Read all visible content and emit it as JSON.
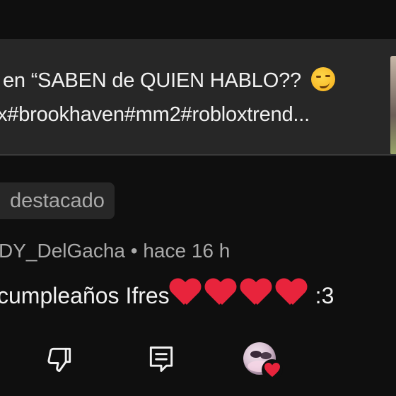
{
  "video_card": {
    "title_line": "en “SABEN de QUIEN HABLO?? ",
    "tags_line": "x#brookhaven#mm2#robloxtrend..."
  },
  "comment": {
    "badge": "destacado",
    "author": "DY_DelGacha",
    "separator": " • ",
    "time": "hace 16 h",
    "text": "cumpleaños Ifres",
    "hearts_count": 4,
    "suffix": ":3"
  },
  "actions": {
    "dislike_icon": "thumbs-down-icon",
    "reply_icon": "reply-icon",
    "creator_heart_icon": "creator-heart-icon"
  },
  "colors": {
    "background": "#0f0f0f",
    "card": "#272727",
    "text": "#f1f1f1",
    "muted": "#aaaaaa",
    "heart": "#e8243c"
  }
}
